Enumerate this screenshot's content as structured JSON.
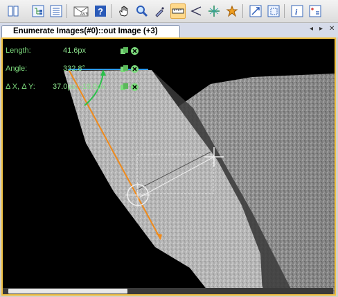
{
  "toolbar": {
    "buttons": [
      {
        "name": "layout-columns-icon"
      },
      {
        "name": "tree-view-icon"
      },
      {
        "name": "list-view-icon"
      },
      {
        "name": "avs-mail-icon",
        "label": "AVS"
      },
      {
        "name": "help-icon",
        "label": "?"
      },
      {
        "name": "hand-pan-icon"
      },
      {
        "name": "zoom-icon"
      },
      {
        "name": "color-picker-icon"
      },
      {
        "name": "ruler-icon",
        "active": true
      },
      {
        "name": "angle-tool-icon"
      },
      {
        "name": "cross-marker-icon"
      },
      {
        "name": "star-marker-icon"
      },
      {
        "name": "diagonal-resize-icon"
      },
      {
        "name": "selection-box-icon"
      },
      {
        "name": "info-icon",
        "label": "i"
      },
      {
        "name": "image-math-icon"
      }
    ]
  },
  "tab": {
    "label": "Enumerate Images(#0)::out Image  (+3)",
    "controls": [
      "◂",
      "▸",
      "✕"
    ]
  },
  "measurements": [
    {
      "label": "Length:",
      "value": "41.6px"
    },
    {
      "label": "Angle:",
      "value": "332.8°"
    },
    {
      "label": "Δ X, Δ Y:",
      "value": "37.0px; -19.0px"
    }
  ],
  "colors": {
    "accent_border": "#f0c040",
    "measure_line": "#f08a1a",
    "info_text": "#7ddc7d"
  }
}
